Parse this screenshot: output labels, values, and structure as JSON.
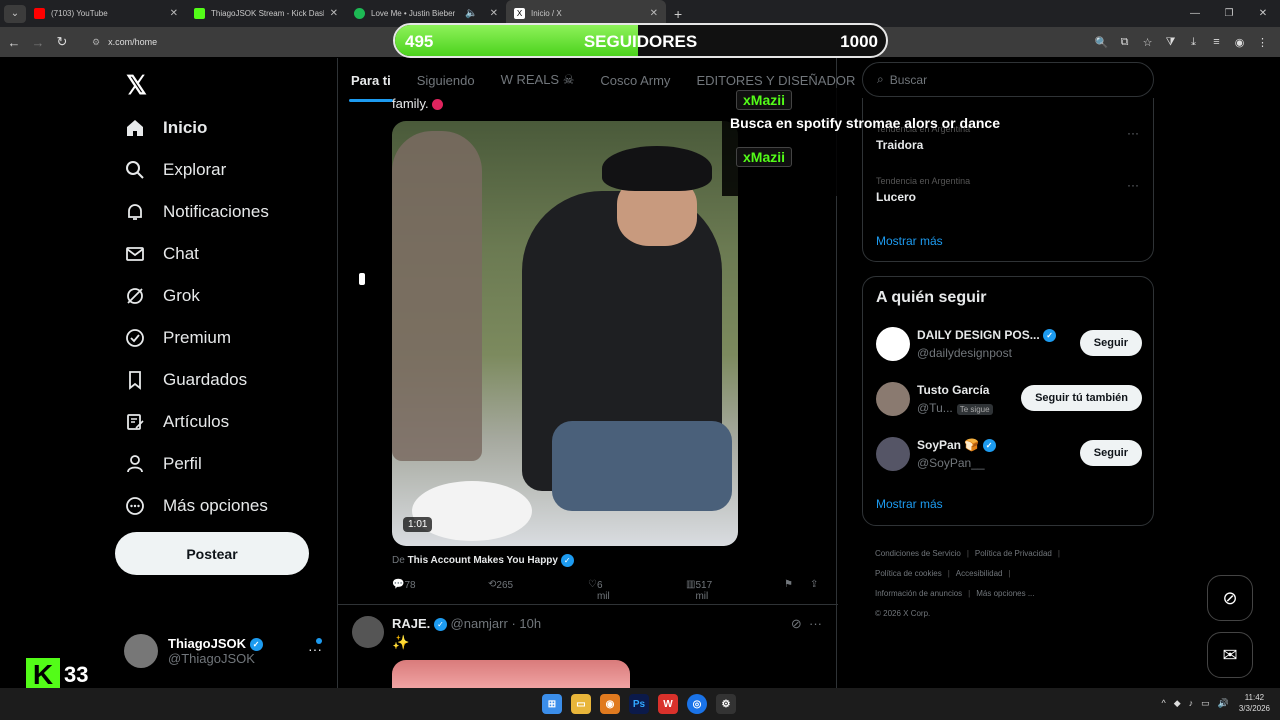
{
  "browser": {
    "tabs": [
      {
        "title": "(7103) YouTube",
        "color": "#ff0000"
      },
      {
        "title": "ThiagoJSOK Stream - Kick Dashboard",
        "color": "#53fc18"
      },
      {
        "title": "Love Me • Justin Bieber",
        "color": "#1db954"
      },
      {
        "title": "Inicio / X",
        "color": "#ffffff"
      }
    ],
    "url": "x.com/home"
  },
  "overlay": {
    "current": "495",
    "label": "SEGUIDORES",
    "goal": "1000",
    "progress": 0.495,
    "chat_user": "xMazii",
    "chat_message": "Busca en spotify stromae alors or dance"
  },
  "sidebar": {
    "items": [
      {
        "label": "Inicio",
        "icon": "home-icon"
      },
      {
        "label": "Explorar",
        "icon": "search-icon"
      },
      {
        "label": "Notificaciones",
        "icon": "bell-icon"
      },
      {
        "label": "Chat",
        "icon": "mail-icon"
      },
      {
        "label": "Grok",
        "icon": "grok-icon"
      },
      {
        "label": "Premium",
        "icon": "verified-icon"
      },
      {
        "label": "Guardados",
        "icon": "bookmark-icon"
      },
      {
        "label": "Artículos",
        "icon": "article-icon"
      },
      {
        "label": "Perfil",
        "icon": "person-icon"
      },
      {
        "label": "Más opciones",
        "icon": "more-circle-icon"
      }
    ],
    "post_label": "Postear",
    "account": {
      "name": "ThiagoJSOK",
      "handle": "@ThiagoJSOK"
    }
  },
  "kick": {
    "number": "33"
  },
  "timeline": {
    "tabs": [
      "Para ti",
      "Siguiendo",
      "W REALS ☠",
      "Cosco Army",
      "EDITORES Y DISEÑADOR"
    ],
    "tweet1": {
      "text_tail": "family.",
      "video_duration": "1:01",
      "from_prefix": "De",
      "from_account": "This Account Makes You Happy",
      "replies": "78",
      "reposts": "265",
      "likes": "6 mil",
      "views": "517 mil"
    },
    "tweet2": {
      "name": "RAJE.",
      "handle": "@namjarr",
      "time": "· 10h",
      "text": "✨"
    }
  },
  "right": {
    "search_placeholder": "Buscar",
    "trends": [
      {
        "context": "Tendencia en Argentina",
        "title": "Traidora"
      },
      {
        "context": "Tendencia en Argentina",
        "title": "Lucero"
      }
    ],
    "trends_more": "Mostrar más",
    "follow_title": "A quién seguir",
    "follow": [
      {
        "name": "DAILY DESIGN POS...",
        "handle": "@dailydesignpost",
        "button": "Seguir",
        "tag": ""
      },
      {
        "name": "Tusto García",
        "handle": "@Tu...",
        "button": "Seguir tú también",
        "tag": "Te sigue"
      },
      {
        "name": "SoyPan 🍞",
        "handle": "@SoyPan__",
        "button": "Seguir",
        "tag": ""
      }
    ],
    "follow_more": "Mostrar más",
    "footer": [
      "Condiciones de Servicio",
      "Política de Privacidad",
      "Política de cookies",
      "Accesibilidad",
      "Información de anuncios",
      "Más opciones ...",
      "© 2026 X Corp."
    ]
  },
  "taskbar": {
    "time": "11:42",
    "date": "3/3/2026"
  }
}
